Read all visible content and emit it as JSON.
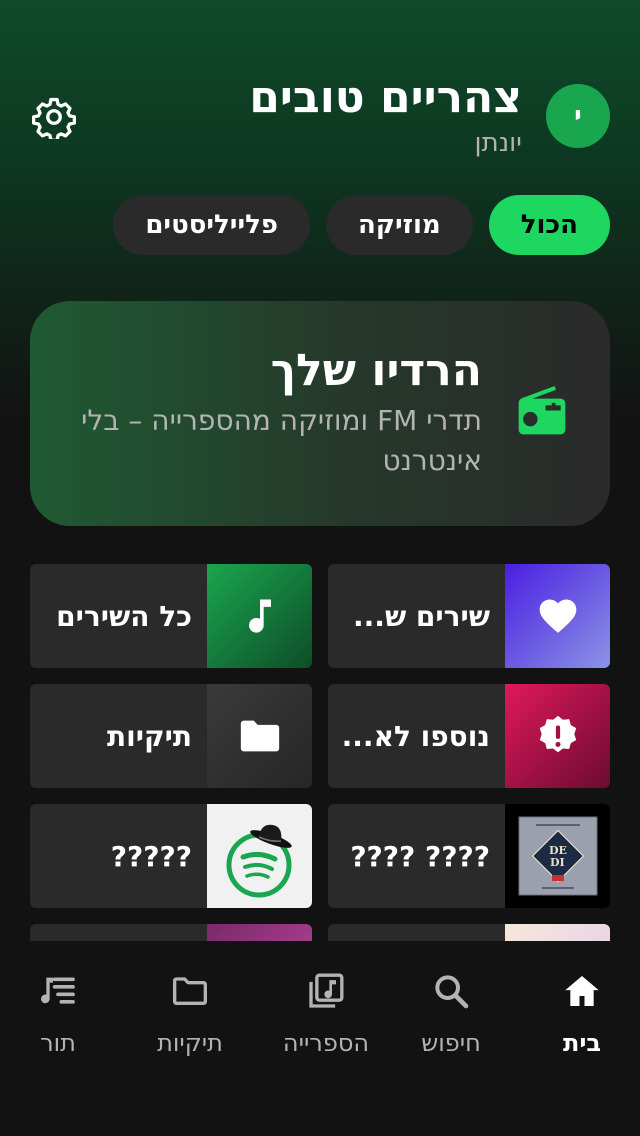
{
  "header": {
    "greeting": "צהריים טובים",
    "username": "יונתן",
    "avatar_letter": "י",
    "accent": "#1ed760"
  },
  "chips": [
    {
      "label": "הכול",
      "active": true
    },
    {
      "label": "מוזיקה",
      "active": false
    },
    {
      "label": "פלייליסטים",
      "active": false
    }
  ],
  "radio_card": {
    "title": "הרדיו שלך",
    "description": "תדרי FM ומוזיקה מהספרייה – בלי אינטרנט",
    "icon": "radio-icon"
  },
  "tiles": [
    {
      "label": "שירים ש...",
      "icon": "heart-icon"
    },
    {
      "label": "כל השירים",
      "icon": "music-note-icon"
    },
    {
      "label": "נוספו לא...",
      "icon": "alert-badge-icon"
    },
    {
      "label": "תיקיות",
      "icon": "folder-icon"
    },
    {
      "label": "???? ????",
      "icon": "album-art"
    },
    {
      "label": "?????",
      "icon": "spotify-logo"
    }
  ],
  "nav": [
    {
      "label": "בית",
      "icon": "home-icon",
      "active": true
    },
    {
      "label": "חיפוש",
      "icon": "search-icon",
      "active": false
    },
    {
      "label": "הספרייה",
      "icon": "library-icon",
      "active": false
    },
    {
      "label": "תיקיות",
      "icon": "folder-icon",
      "active": false
    },
    {
      "label": "תור",
      "icon": "queue-icon",
      "active": false
    }
  ]
}
